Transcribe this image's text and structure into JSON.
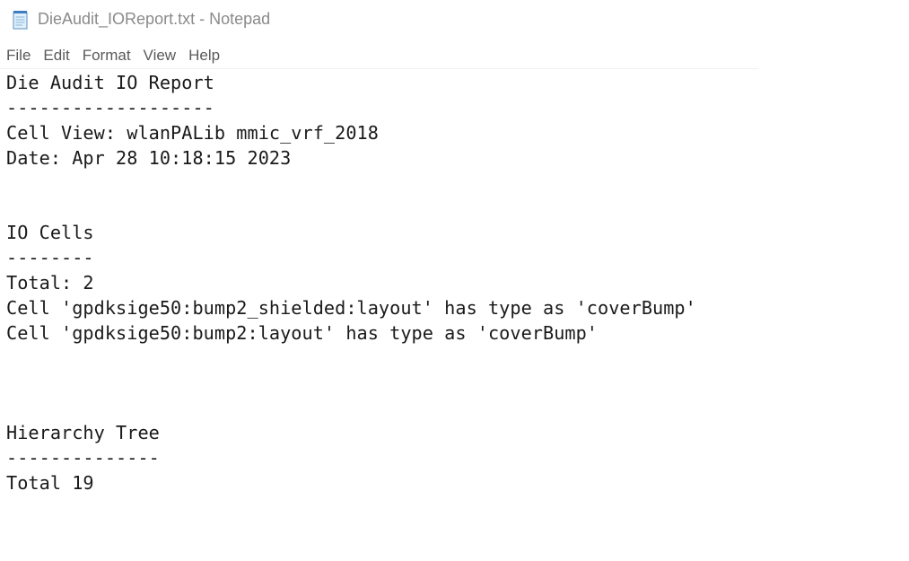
{
  "window": {
    "title": "DieAudit_IOReport.txt - Notepad",
    "icon": "notepad-icon"
  },
  "menu": {
    "items": [
      "File",
      "Edit",
      "Format",
      "View",
      "Help"
    ]
  },
  "document": {
    "lines": [
      "Die Audit IO Report",
      "-------------------",
      "Cell View: wlanPALib mmic_vrf_2018",
      "Date: Apr 28 10:18:15 2023",
      "",
      "",
      "IO Cells",
      "--------",
      "Total: 2",
      "Cell 'gpdksige50:bump2_shielded:layout' has type as 'coverBump'",
      "Cell 'gpdksige50:bump2:layout' has type as 'coverBump'",
      "",
      "",
      "",
      "Hierarchy Tree",
      "--------------",
      "Total 19"
    ]
  }
}
